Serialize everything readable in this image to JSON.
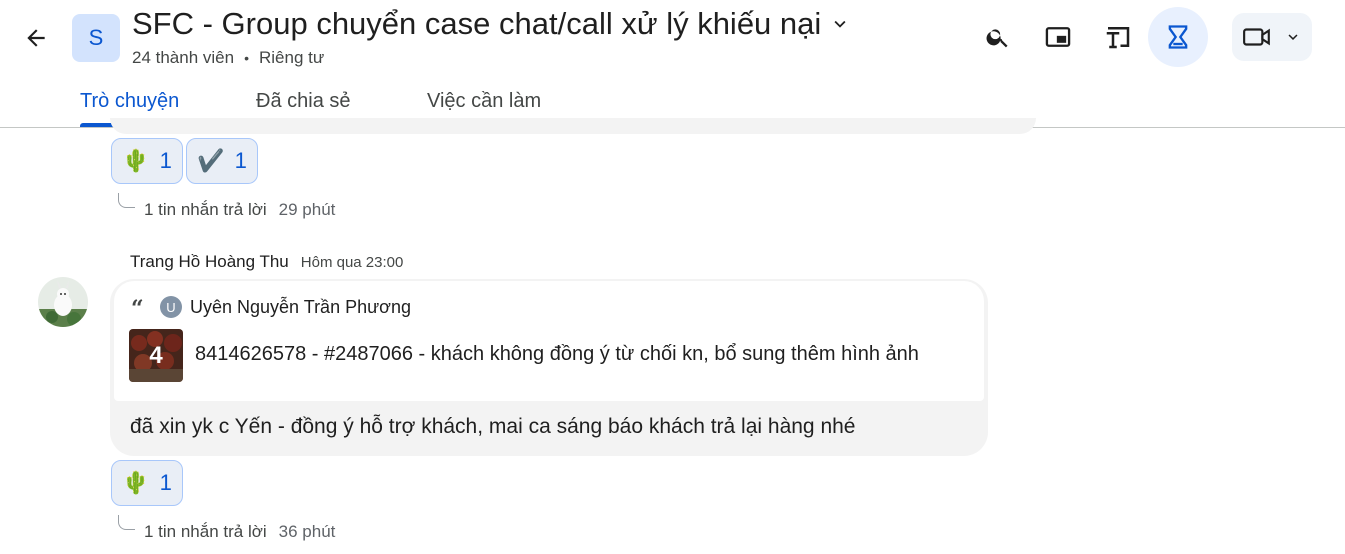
{
  "header": {
    "space_initial": "S",
    "title": "SFC - Group chuyển case chat/call xử lý khiếu nại",
    "members": "24 thành viên",
    "separator": "•",
    "privacy": "Riêng tư"
  },
  "icons": {
    "back": "arrow-back-icon",
    "dropdown": "chevron-down-icon",
    "search": "search-icon",
    "pip": "picture-in-picture-icon",
    "cast": "cast-icon",
    "tasks": "tasks-icon",
    "video": "video-camera-icon"
  },
  "tabs": [
    {
      "label": "Trò chuyện",
      "active": true
    },
    {
      "label": "Đã chia sẻ",
      "active": false
    },
    {
      "label": "Việc cần làm",
      "active": false
    }
  ],
  "previous_message": {
    "reactions": [
      {
        "emoji": "🌵",
        "count": "1"
      },
      {
        "emoji": "✔️",
        "count": "1"
      }
    ],
    "replies": "1 tin nhắn trả lời",
    "reply_time": "29 phút"
  },
  "message": {
    "sender": "Trang Hồ Hoàng Thu",
    "time": "Hôm qua 23:00",
    "quote": {
      "mark": "“",
      "author_initial": "U",
      "author": "Uyên Nguyễn Trần Phương",
      "attachment_count": "4",
      "text": "8414626578 - #2487066 - khách không đồng ý từ chối kn, bổ sung thêm hình ảnh"
    },
    "text": "đã xin yk c Yến - đồng ý hỗ trợ khách, mai ca sáng báo khách trả lại hàng nhé",
    "reactions": [
      {
        "emoji": "🌵",
        "count": "1"
      }
    ],
    "replies": "1 tin nhắn trả lời",
    "reply_time": "36 phút"
  },
  "colors": {
    "accent": "#0b57d0",
    "reaction_bg": "#e9eef6",
    "bubble_bg": "#f3f3f3"
  }
}
